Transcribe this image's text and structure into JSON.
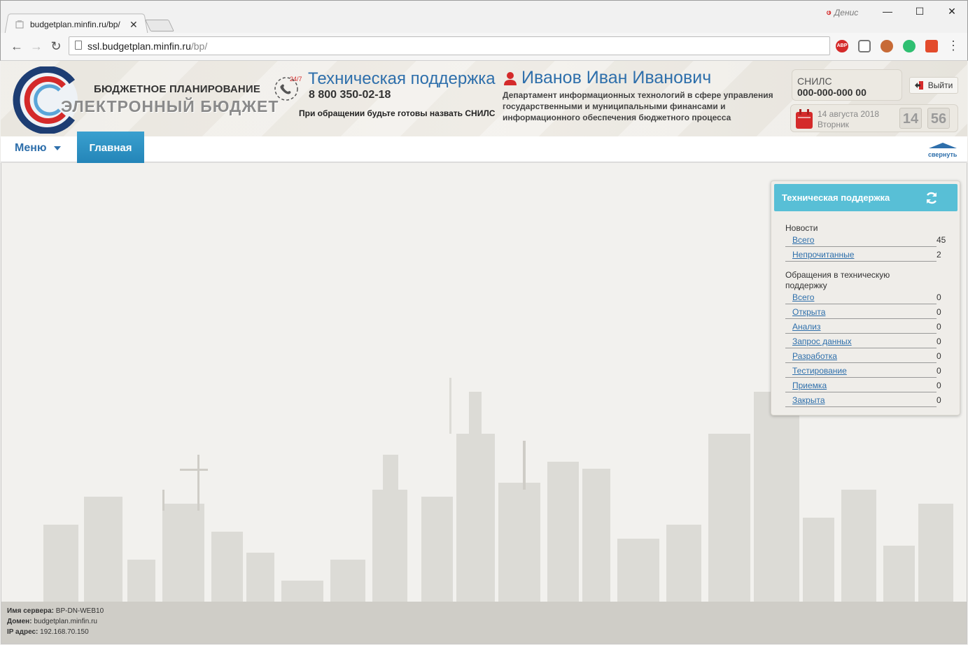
{
  "browser": {
    "tab_title": "budgetplan.minfin.ru/bp/",
    "profile_name": "Денис",
    "url_host": "ssl.budgetplan.minfin.ru",
    "url_path": "/bp/",
    "extensions": [
      "adblock-icon",
      "pocket-icon",
      "ext-hat-icon",
      "ext-chat-icon",
      "ext-puzzle-icon"
    ],
    "ext_abp_label": "ABP"
  },
  "header": {
    "brand_top": "БЮДЖЕТНОЕ ПЛАНИРОВАНИЕ",
    "brand_main": "ЭЛЕКТРОННЫЙ БЮДЖЕТ",
    "support_badge": "24/7",
    "support_title": "Техническая поддержка",
    "support_phone": "8 800 350-02-18",
    "support_note": "При обращении будьте готовы назвать СНИЛС",
    "user_name": "Иванов Иван Иванович",
    "user_dept": "Департамент информационных технологий в сфере управления государственными и муниципальными финансами и информационного обеспечения бюджетного процесса",
    "snils_label": "СНИЛС",
    "snils_value": "000-000-000 00",
    "logout_label": "Выйти",
    "date": "14 августа 2018",
    "weekday": "Вторник",
    "clock_hours": "14",
    "clock_minutes": "56"
  },
  "nav": {
    "menu_label": "Меню",
    "home_label": "Главная",
    "collapse_label": "свернуть"
  },
  "widget": {
    "title": "Техническая поддержка",
    "news_title": "Новости",
    "news": [
      {
        "label": "Всего",
        "count": "45"
      },
      {
        "label": "Непрочитанные",
        "count": "2"
      }
    ],
    "requests_title_line1": "Обращения в техническую",
    "requests_title_line2": "поддержку",
    "requests": [
      {
        "label": "Всего",
        "count": "0"
      },
      {
        "label": "Открыта",
        "count": "0"
      },
      {
        "label": "Анализ",
        "count": "0"
      },
      {
        "label": "Запрос данных",
        "count": "0"
      },
      {
        "label": "Разработка",
        "count": "0"
      },
      {
        "label": "Тестирование",
        "count": "0"
      },
      {
        "label": "Приемка",
        "count": "0"
      },
      {
        "label": "Закрыта",
        "count": "0"
      }
    ]
  },
  "server": {
    "name_label": "Имя сервера:",
    "name_value": "BP-DN-WEB10",
    "domain_label": "Домен:",
    "domain_value": "budgetplan.minfin.ru",
    "ip_label": "IP адрес:",
    "ip_value": "192.168.70.150"
  },
  "colors": {
    "accent": "#2e6fab",
    "widget_header": "#58bfd6",
    "home_tab": "#1f7fb3"
  }
}
